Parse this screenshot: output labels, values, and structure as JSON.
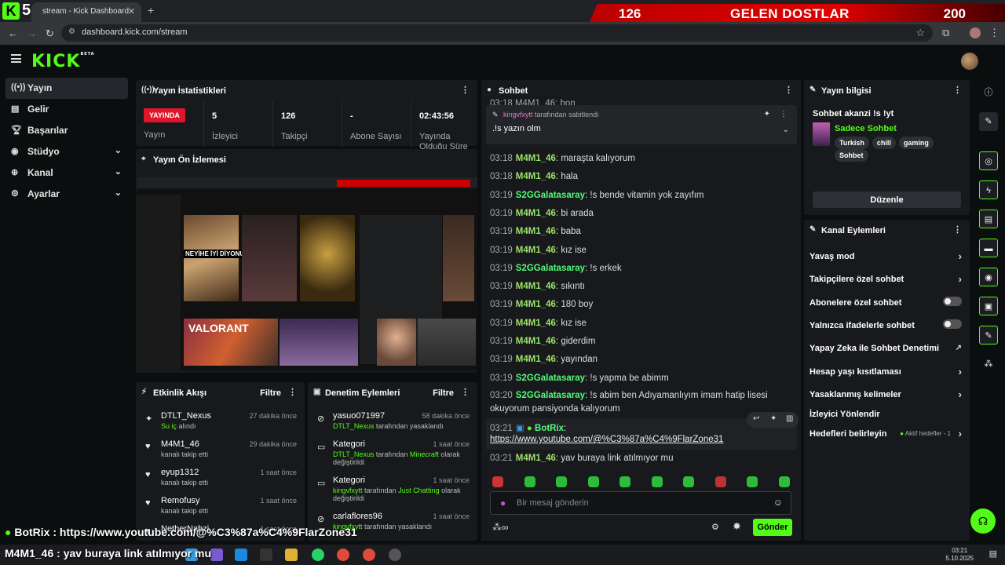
{
  "browser": {
    "tab_title": "stream - Kick Dashboard",
    "url": "dashboard.kick.com/stream"
  },
  "overlay": {
    "corner_number": "5",
    "banner_left": "126",
    "banner_text": "GELEN DOSTLAR",
    "banner_right": "200",
    "bottom_line1": "BotRix : https://www.youtube.com/@%C3%87a%C4%9FlarZone31",
    "bottom_line2": "M4M1_46 : yav buraya link atılmıyor mu"
  },
  "sidebar": {
    "items": [
      {
        "label": "Yayın",
        "icon": "broadcast-icon",
        "active": true
      },
      {
        "label": "Gelir",
        "icon": "income-icon"
      },
      {
        "label": "Başarılar",
        "icon": "trophy-icon"
      },
      {
        "label": "Stüdyo",
        "icon": "studio-icon",
        "chevron": true
      },
      {
        "label": "Kanal",
        "icon": "channel-icon",
        "chevron": true
      },
      {
        "label": "Ayarlar",
        "icon": "settings-icon",
        "chevron": true
      }
    ]
  },
  "stats": {
    "title": "Yayın İstatistikleri",
    "live_badge": "YAYINDA",
    "live_label": "Yayın",
    "viewers": "5",
    "viewers_label": "İzleyici",
    "followers": "126",
    "followers_label": "Takipçi",
    "subs": "-",
    "subs_label": "Abone Sayısı",
    "duration": "02:43:56",
    "duration_label": "Yayında Olduğu Süre"
  },
  "preview": {
    "title": "Yayın Ön İzlemesi",
    "thumb_caption": "NEYİHE İYİ DİYONUZ!",
    "thumb_game": "VALORANT"
  },
  "activity": {
    "title": "Etkinlik Akışı",
    "filter": "Filtre",
    "items": [
      {
        "name": "DTLT_Nexus",
        "sub_green": "Su iç",
        "sub": " alındı",
        "time": "27 dakika önce",
        "icon": "redeem-icon"
      },
      {
        "name": "M4M1_46",
        "sub": "kanalı takip etti",
        "time": "29 dakika önce",
        "icon": "heart-icon"
      },
      {
        "name": "eyup1312",
        "sub": "kanalı takip etti",
        "time": "1 saat önce",
        "icon": "heart-icon"
      },
      {
        "name": "Remofusy",
        "sub": "kanalı takip etti",
        "time": "1 saat önce",
        "icon": "heart-icon"
      },
      {
        "name": "NetherNabzi",
        "sub": "",
        "time": "1 saat önce",
        "icon": "heart-icon"
      }
    ]
  },
  "moderation": {
    "title": "Denetim Eylemleri",
    "filter": "Filtre",
    "items": [
      {
        "name": "yasuo071997",
        "line1_green": "DTLT_Nexus",
        "line1": " tarafından yasaklandı",
        "line2": "",
        "time": "58 dakika önce",
        "icon": "ban-icon"
      },
      {
        "name": "Kategori",
        "line1_green": "DTLT_Nexus",
        "line1": " tarafından ",
        "line1_green2": "Minecraft",
        "line1b": " olarak",
        "line2": "değiştirildi",
        "time": "1 saat önce",
        "icon": "category-icon"
      },
      {
        "name": "Kategori",
        "line1_green": "kingvfxytt",
        "line1": " tarafından ",
        "line1_green2": "Just Chatting",
        "line1b": " olarak",
        "line2": "değiştirildi",
        "time": "1 saat önce",
        "icon": "category-icon"
      },
      {
        "name": "carlaflores96",
        "line1_green": "kingvfxytt",
        "line1": " tarafından yasaklandı",
        "line2": "",
        "time": "1 saat önce",
        "icon": "ban-icon"
      }
    ]
  },
  "chat": {
    "title": "Sohbet",
    "top_partial": "03:18 M4M1_46: bon",
    "pinned_by_user": "kingvfxytt",
    "pinned_by_text": "tarafından sabitlendi",
    "pinned_message": ".!s yazın olm",
    "messages": [
      {
        "time": "03:18",
        "user": "M4M1_46",
        "cls": "u1",
        "text": "maraşta kalıyorum"
      },
      {
        "time": "03:18",
        "user": "M4M1_46",
        "cls": "u1",
        "text": "hala"
      },
      {
        "time": "03:19",
        "user": "S2GGalatasaray",
        "cls": "u2",
        "text": "!s bende vitamin yok zayıfım"
      },
      {
        "time": "03:19",
        "user": "M4M1_46",
        "cls": "u1",
        "text": "bi arada"
      },
      {
        "time": "03:19",
        "user": "M4M1_46",
        "cls": "u1",
        "text": "baba"
      },
      {
        "time": "03:19",
        "user": "M4M1_46",
        "cls": "u1",
        "text": "kız ise"
      },
      {
        "time": "03:19",
        "user": "S2GGalatasaray",
        "cls": "u2",
        "text": "!s erkek"
      },
      {
        "time": "03:19",
        "user": "M4M1_46",
        "cls": "u1",
        "text": "sıkıntı"
      },
      {
        "time": "03:19",
        "user": "M4M1_46",
        "cls": "u1",
        "text": "180 boy"
      },
      {
        "time": "03:19",
        "user": "M4M1_46",
        "cls": "u1",
        "text": "kız ise"
      },
      {
        "time": "03:19",
        "user": "M4M1_46",
        "cls": "u1",
        "text": "giderdim"
      },
      {
        "time": "03:19",
        "user": "M4M1_46",
        "cls": "u1",
        "text": "yayından"
      },
      {
        "time": "03:19",
        "user": "S2GGalatasaray",
        "cls": "u2",
        "text": "!s yapma be abimm"
      }
    ],
    "long_msg": {
      "time": "03:20",
      "user": "S2GGalatasaray",
      "text1": "!s abim ben Adıyamanlıyım imam hatip lisesi",
      "text2": "okuyorum pansiyonda kalıyorum"
    },
    "bot_msg": {
      "time": "03:21",
      "user": "BotRix",
      "link": "https://www.youtube.com/@%C3%87a%C4%9FlarZone31"
    },
    "last_msg": {
      "time": "03:21",
      "user": "M4M1_46",
      "text": "yav buraya link atılmıyor mu"
    },
    "input_placeholder": "Bir mesaj gönderin",
    "send": "Gönder"
  },
  "info": {
    "title": "Yayın bilgisi",
    "stream_title": "Sohbet akanzi !s !yt",
    "category": "Sadece Sohbet",
    "tags": [
      "Turkish",
      "chill",
      "gaming",
      "Sohbet"
    ],
    "edit": "Düzenle"
  },
  "actions": {
    "title": "Kanal Eylemleri",
    "rows": [
      {
        "label": "Yavaş mod",
        "kind": "arrow"
      },
      {
        "label": "Takipçilere özel sohbet",
        "kind": "arrow"
      },
      {
        "label": "Abonelere özel sohbet",
        "kind": "toggle"
      },
      {
        "label": "Yalnızca ifadelerle sohbet",
        "kind": "toggle"
      },
      {
        "label": "Yapay Zeka ile Sohbet Denetimi",
        "kind": "external"
      },
      {
        "label": "Hesap yaşı kısıtlaması",
        "kind": "arrow"
      },
      {
        "label": "Yasaklanmış kelimeler",
        "kind": "arrow"
      },
      {
        "label": "İzleyici Yönlendir",
        "kind": "none"
      },
      {
        "label": "Hedefleri belirleyin",
        "kind": "arrow",
        "extra": "Aktif hedefler - 1"
      }
    ]
  },
  "taskbar": {
    "time": "03:21",
    "date": "5.10.2025"
  },
  "colors": {
    "accent": "#53fc18",
    "live": "#e0152a",
    "panel": "#17191c"
  }
}
